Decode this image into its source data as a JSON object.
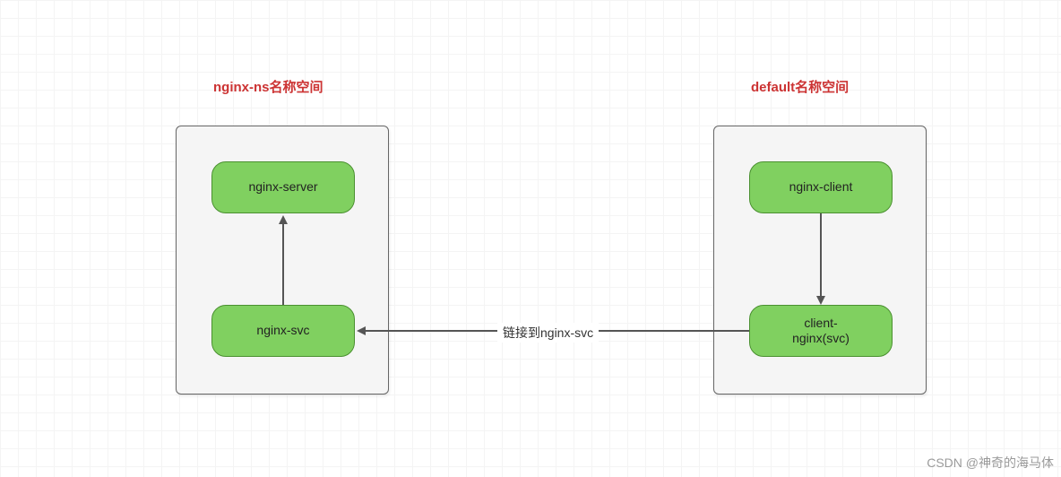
{
  "chart_data": {
    "type": "diagram",
    "namespaces": [
      {
        "id": "nginx-ns",
        "title": "nginx-ns名称空间",
        "nodes": [
          "nginx-server",
          "nginx-svc"
        ]
      },
      {
        "id": "default",
        "title": "default名称空间",
        "nodes": [
          "nginx-client",
          "client-nginx(svc)"
        ]
      }
    ],
    "edges": [
      {
        "from": "nginx-svc",
        "to": "nginx-server",
        "label": null
      },
      {
        "from": "nginx-client",
        "to": "client-nginx(svc)",
        "label": null
      },
      {
        "from": "client-nginx(svc)",
        "to": "nginx-svc",
        "label": "链接到nginx-svc"
      }
    ]
  },
  "titles": {
    "left": "nginx-ns名称空间",
    "right": "default名称空间"
  },
  "nodes": {
    "server": "nginx-server",
    "svc": "nginx-svc",
    "client": "nginx-client",
    "clientSvc": "client-\nnginx(svc)"
  },
  "edgeLabel": "链接到nginx-svc",
  "watermark": "CSDN @神奇的海马体"
}
